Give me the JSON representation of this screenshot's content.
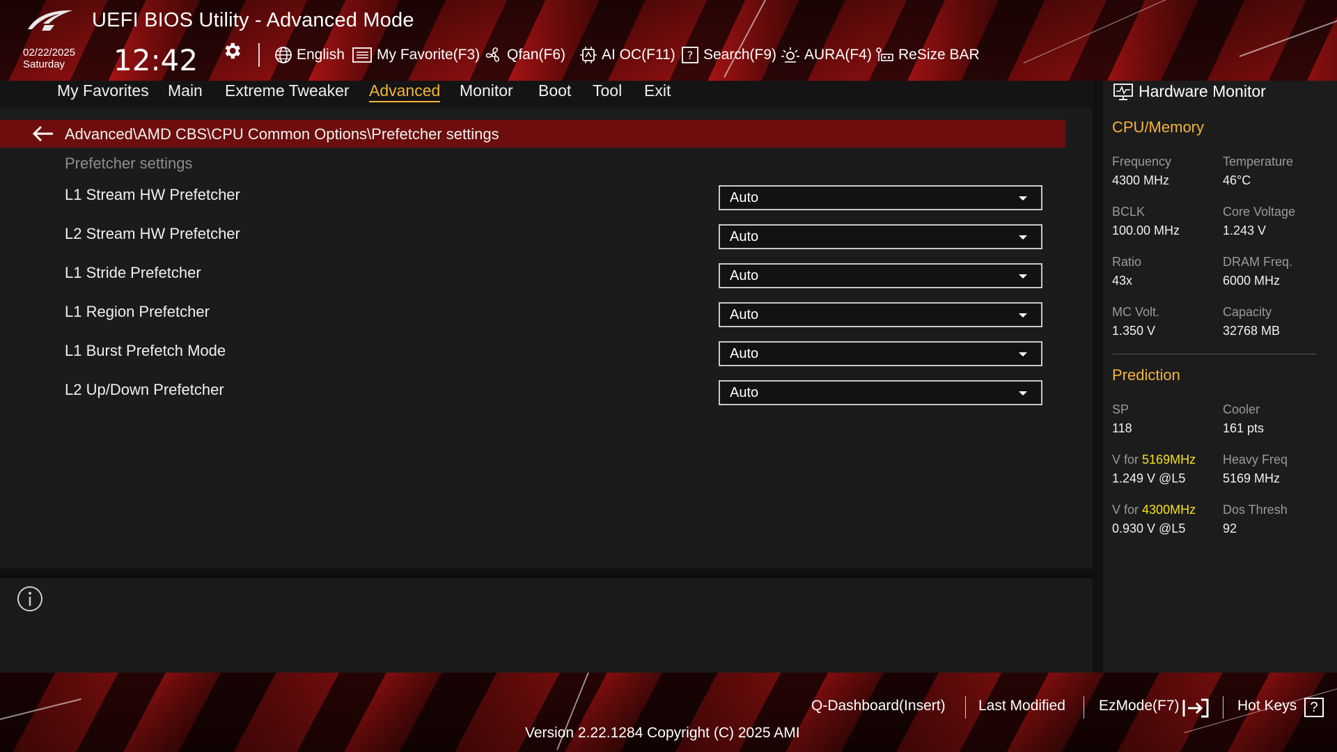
{
  "header": {
    "title": "UEFI BIOS Utility - Advanced Mode",
    "date": "02/22/2025",
    "weekday": "Saturday",
    "time": "12:42",
    "toolbar": {
      "language": "English",
      "my_favorite": "My Favorite(F3)",
      "qfan": "Qfan(F6)",
      "ai_oc": "AI OC(F11)",
      "search": "Search(F9)",
      "aura": "AURA(F4)",
      "resize_bar": "ReSize BAR"
    }
  },
  "tabs": [
    "My Favorites",
    "Main",
    "Extreme Tweaker",
    "Advanced",
    "Monitor",
    "Boot",
    "Tool",
    "Exit"
  ],
  "active_tab": "Advanced",
  "main": {
    "breadcrumb": "Advanced\\AMD CBS\\CPU Common Options\\Prefetcher settings",
    "section_label": "Prefetcher settings",
    "options": [
      {
        "label": "L1 Stream HW Prefetcher",
        "value": "Auto"
      },
      {
        "label": "L2 Stream HW Prefetcher",
        "value": "Auto"
      },
      {
        "label": "L1 Stride Prefetcher",
        "value": "Auto"
      },
      {
        "label": "L1 Region Prefetcher",
        "value": "Auto"
      },
      {
        "label": "L1 Burst Prefetch Mode",
        "value": "Auto"
      },
      {
        "label": "L2 Up/Down Prefetcher",
        "value": "Auto"
      }
    ]
  },
  "hardware_monitor": {
    "title": "Hardware Monitor",
    "cpu_memory": {
      "heading": "CPU/Memory",
      "frequency_label": "Frequency",
      "frequency": "4300 MHz",
      "temperature_label": "Temperature",
      "temperature": "46°C",
      "bclk_label": "BCLK",
      "bclk": "100.00 MHz",
      "core_voltage_label": "Core Voltage",
      "core_voltage": "1.243 V",
      "ratio_label": "Ratio",
      "ratio": "43x",
      "dram_freq_label": "DRAM Freq.",
      "dram_freq": "6000 MHz",
      "mc_volt_label": "MC Volt.",
      "mc_volt": "1.350 V",
      "capacity_label": "Capacity",
      "capacity": "32768 MB"
    },
    "prediction": {
      "heading": "Prediction",
      "sp_label": "SP",
      "sp": "118",
      "cooler_label": "Cooler",
      "cooler": "161 pts",
      "v_for_label": "V for",
      "v_for_1_freq": "5169MHz",
      "v_for_1": "1.249 V @L5",
      "heavy_freq_label": "Heavy Freq",
      "heavy_freq": "5169 MHz",
      "v_for_2_freq": "4300MHz",
      "v_for_2": "0.930 V @L5",
      "dos_thresh_label": "Dos Thresh",
      "dos_thresh": "92"
    }
  },
  "footer": {
    "q_dashboard": "Q-Dashboard(Insert)",
    "last_modified": "Last Modified",
    "ezmode": "EzMode(F7)",
    "hot_keys": "Hot Keys",
    "hot_keys_glyph": "?",
    "version": "Version 2.22.1284 Copyright (C) 2025 AMI"
  },
  "colors": {
    "accent": "#f4b437",
    "highlight": "#f4e21a",
    "breadcrumb_bg": "#6d0d0d",
    "panel_bg": "#1b1b1b"
  }
}
